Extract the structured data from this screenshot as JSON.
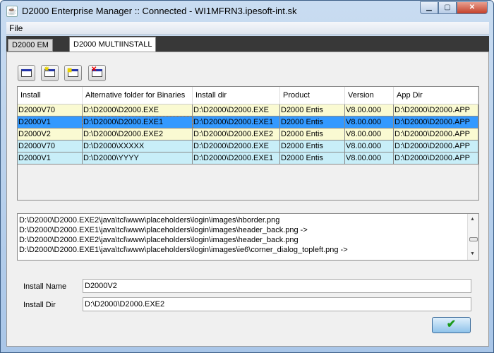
{
  "window": {
    "title": "D2000 Enterprise Manager :: Connected - WI1MFRN3.ipesoft-int.sk"
  },
  "menu": {
    "file": "File"
  },
  "tabs": [
    {
      "label": "D2000 EM"
    },
    {
      "label": "D2000 MULTIINSTALL"
    }
  ],
  "toolbar": [
    "list-icon",
    "new-list-icon",
    "folder-list-icon",
    "delete-list-icon"
  ],
  "table": {
    "columns": [
      "Install",
      "Alternative folder for Binaries",
      "Install dir",
      "Product",
      "Version",
      "App Dir"
    ],
    "rows": [
      [
        "D2000V70",
        "D:\\D2000\\D2000.EXE",
        "D:\\D2000\\D2000.EXE",
        "D2000 Entis",
        "V8.00.000",
        "D:\\D2000\\D2000.APP"
      ],
      [
        "D2000V1",
        "D:\\D2000\\D2000.EXE1",
        "D:\\D2000\\D2000.EXE1",
        "D2000 Entis",
        "V8.00.000",
        "D:\\D2000\\D2000.APP"
      ],
      [
        "D2000V2",
        "D:\\D2000\\D2000.EXE2",
        "D:\\D2000\\D2000.EXE2",
        "D2000 Entis",
        "V8.00.000",
        "D:\\D2000\\D2000.APP"
      ],
      [
        "D2000V70",
        "D:\\D2000\\XXXXX",
        "D:\\D2000\\D2000.EXE",
        "D2000 Entis",
        "V8.00.000",
        "D:\\D2000\\D2000.APP"
      ],
      [
        "D2000V1",
        "D:\\D2000\\YYYY",
        "D:\\D2000\\D2000.EXE1",
        "D2000 Entis",
        "V8.00.000",
        "D:\\D2000\\D2000.APP"
      ]
    ],
    "row_colors": [
      "#fafad2",
      "#3399ff",
      "#fafad2",
      "#c8eef8",
      "#c8eef8"
    ],
    "selected_row": 1
  },
  "log": [
    "D:\\D2000\\D2000.EXE2\\java\\tcl\\www\\placeholders\\login\\images\\hborder.png",
    "D:\\D2000\\D2000.EXE1\\java\\tcl\\www\\placeholders\\login\\images\\header_back.png ->",
    "D:\\D2000\\D2000.EXE2\\java\\tcl\\www\\placeholders\\login\\images\\header_back.png",
    "D:\\D2000\\D2000.EXE1\\java\\tcl\\www\\placeholders\\login\\images\\ie6\\corner_dialog_topleft.png ->"
  ],
  "form": {
    "install_name_label": "Install Name",
    "install_name": "D2000V2",
    "install_dir_label": "Install Dir",
    "install_dir": "D:\\D2000\\D2000.EXE2"
  },
  "ok_icon": "✔"
}
